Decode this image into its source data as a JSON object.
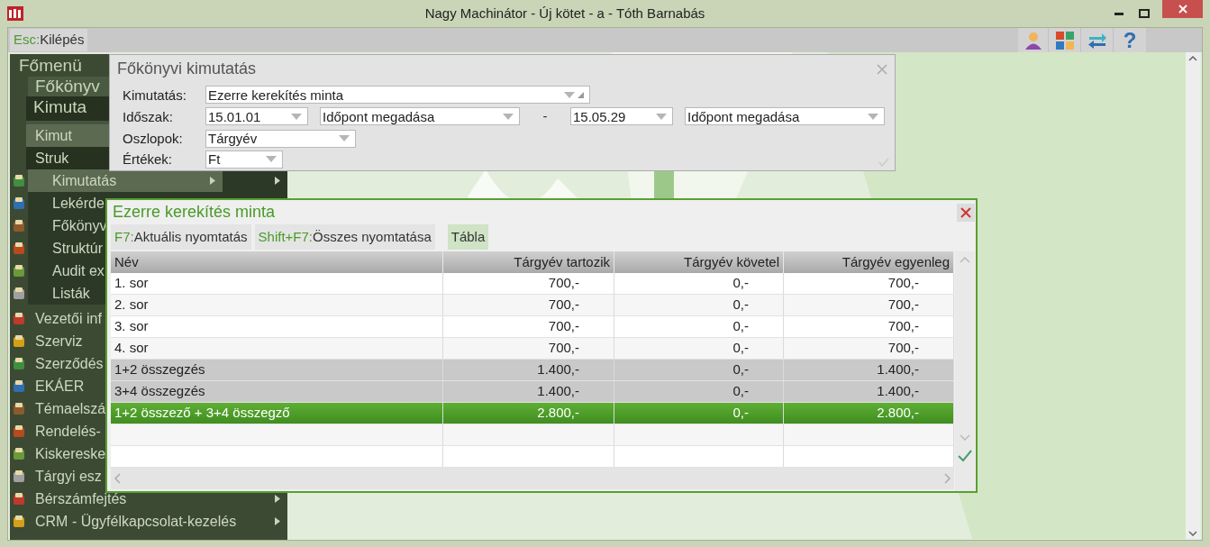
{
  "window": {
    "title": "Nagy Machinátor - Új kötet - a - Tóth Barnabás"
  },
  "toolbar": {
    "exit": {
      "key": "Esc:",
      "label": "Kilépés"
    },
    "help": "?"
  },
  "menu": {
    "title": "Főmenü",
    "items": [
      {
        "label": "Főkönyv",
        "expanded": true,
        "children": [
          {
            "label": "Kimuta",
            "expanded": true,
            "children": [
              {
                "label": "Kimut",
                "selected": true
              },
              {
                "label": "Struk",
                "selected": false
              }
            ]
          },
          {
            "label": "Kimutatás",
            "selected": true,
            "submenu": true
          },
          {
            "label": "Lekérde",
            "selected": false
          },
          {
            "label": "Főkönyv",
            "selected": false
          },
          {
            "label": "Struktúr",
            "selected": false
          },
          {
            "label": "Audit ex",
            "selected": false
          },
          {
            "label": "Listák",
            "selected": false
          }
        ]
      },
      {
        "label": "Vezetői inf",
        "selected": false
      },
      {
        "label": "Szerviz",
        "selected": false
      },
      {
        "label": "Szerződés",
        "selected": false
      },
      {
        "label": "EKÁER",
        "selected": false
      },
      {
        "label": "Témaelszá",
        "selected": false
      },
      {
        "label": "Rendelés-",
        "selected": false
      },
      {
        "label": "Kiskereske",
        "selected": false
      },
      {
        "label": "Tárgyi esz",
        "selected": false
      },
      {
        "label": "Bérszámfejtés",
        "selected": false,
        "submenu": true
      },
      {
        "label": "CRM - Ügyfélkapcsolat-kezelés",
        "selected": false,
        "submenu": true
      }
    ]
  },
  "report_dialog": {
    "title": "Főkönyvi kimutatás",
    "rows": [
      {
        "label": "Kimutatás:",
        "controls": [
          {
            "kind": "combo",
            "value": "Ezerre kerekítés minta"
          }
        ]
      },
      {
        "label": "Időszak:",
        "controls": [
          {
            "kind": "date",
            "value": "15.01.01"
          },
          {
            "kind": "mode",
            "value": "Időpont megadása"
          },
          {
            "kind": "separator",
            "value": "-"
          },
          {
            "kind": "date",
            "value": "15.05.29"
          },
          {
            "kind": "mode",
            "value": "Időpont megadása"
          }
        ]
      },
      {
        "label": "Oszlopok:",
        "controls": [
          {
            "kind": "columns",
            "value": "Tárgyév"
          }
        ]
      },
      {
        "label": "Értékek:",
        "controls": [
          {
            "kind": "unit",
            "value": "Ft"
          }
        ]
      }
    ]
  },
  "table_window": {
    "title": "Ezerre kerekítés minta",
    "actions": [
      {
        "key": "F7:",
        "label": "Aktuális nyomtatás",
        "selected": false
      },
      {
        "key": "Shift+F7:",
        "label": "Összes nyomtatása",
        "selected": false
      },
      {
        "label": "Tábla",
        "selected": true
      }
    ],
    "table": {
      "columns": [
        "Név",
        "Tárgyév tartozik",
        "Tárgyév követel",
        "Tárgyév egyenleg"
      ],
      "rows": [
        {
          "kind": "item",
          "selected": false,
          "cells": [
            "1. sor",
            "700,-",
            "0,-",
            "700,-"
          ]
        },
        {
          "kind": "item",
          "selected": false,
          "cells": [
            "2. sor",
            "700,-",
            "0,-",
            "700,-"
          ]
        },
        {
          "kind": "item",
          "selected": false,
          "cells": [
            "3. sor",
            "700,-",
            "0,-",
            "700,-"
          ]
        },
        {
          "kind": "item",
          "selected": false,
          "cells": [
            "4. sor",
            "700,-",
            "0,-",
            "700,-"
          ]
        },
        {
          "kind": "sum",
          "selected": false,
          "cells": [
            "1+2 összegzés",
            "1.400,-",
            "0,-",
            "1.400,-"
          ]
        },
        {
          "kind": "sum",
          "selected": false,
          "cells": [
            "3+4 összegzés",
            "1.400,-",
            "0,-",
            "1.400,-"
          ]
        },
        {
          "kind": "sum",
          "selected": true,
          "cells": [
            "1+2 összező + 3+4 összegző",
            "2.800,-",
            "0,-",
            "2.800,-"
          ]
        },
        {
          "kind": "empty",
          "selected": false
        },
        {
          "kind": "empty",
          "selected": false
        }
      ]
    }
  }
}
